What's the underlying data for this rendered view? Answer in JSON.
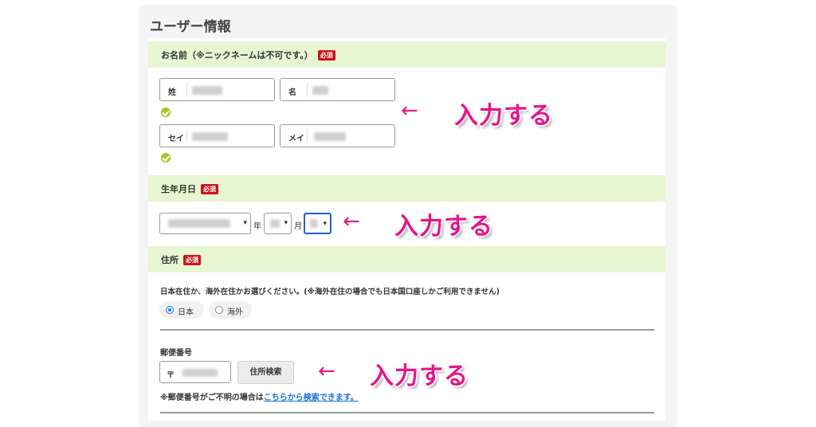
{
  "section": {
    "title": "ユーザー情報"
  },
  "name_block": {
    "label": "お名前（※ニックネームは不可です。）",
    "required": "必須",
    "last_name_label": "姓",
    "first_name_label": "名",
    "last_kana_label": "セイ",
    "first_kana_label": "メイ"
  },
  "birth_block": {
    "label": "生年月日",
    "required": "必須",
    "year_unit": "年",
    "month_unit": "月"
  },
  "address_block": {
    "label": "住所",
    "required": "必須",
    "residence_question": "日本在住か、海外在住かお選びください。(※海外在住の場合でも日本国口座しかご利用できません)",
    "option_japan": "日本",
    "option_overseas": "海外",
    "selected": "日本",
    "postal_label": "郵便番号",
    "postal_prefix": "〒",
    "search_button": "住所検索",
    "postal_note_prefix": "※郵便番号がご不明の場合は",
    "postal_note_link": "こちらから検索できます。"
  },
  "annotations": {
    "arrow": "←",
    "text": "入力する"
  },
  "colors": {
    "accent_pink": "#e5168a",
    "section_bar": "#e8f5d2",
    "required_badge": "#c8161d",
    "check_green": "#a9c628",
    "link_blue": "#1a6fd0"
  }
}
